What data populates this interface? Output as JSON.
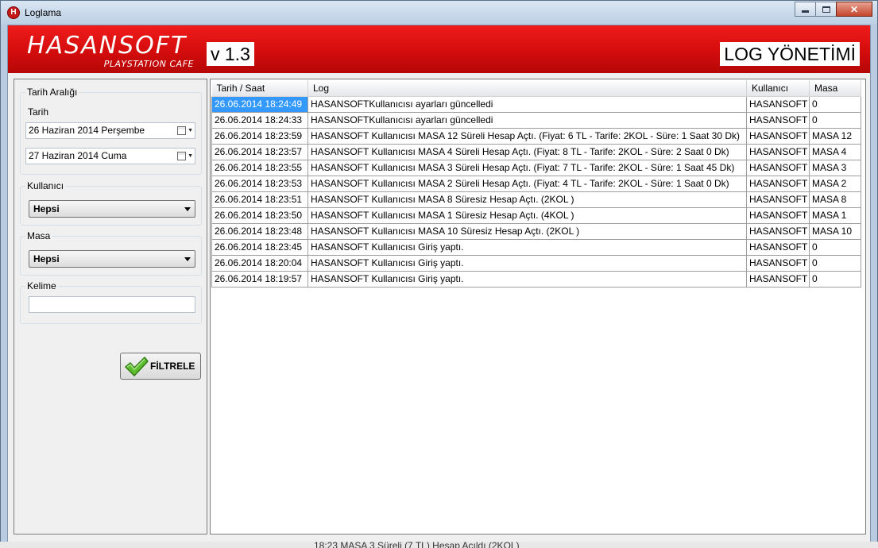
{
  "window": {
    "title": "Loglama",
    "app_icon_glyph": "H",
    "close_glyph": "✕"
  },
  "banner": {
    "logo_main": "HASANSOFT",
    "logo_sub": "PLAYSTATION CAFE",
    "version": "v 1.3",
    "page_title": "LOG YÖNETİMİ"
  },
  "filters": {
    "date_range_legend": "Tarih Aralığı",
    "date_label": "Tarih",
    "date_start": "26  Haziran  2014 Perşembe",
    "date_end": "27  Haziran  2014    Cuma",
    "user_legend": "Kullanıcı",
    "user_selected": "Hepsi",
    "table_legend": "Masa",
    "table_selected": "Hepsi",
    "keyword_legend": "Kelime",
    "keyword_value": "",
    "filter_button_label": "FİLTRELE"
  },
  "log_table": {
    "columns": [
      "Tarih / Saat",
      "Log",
      "Kullanıcı",
      "Masa"
    ],
    "rows": [
      [
        "26.06.2014 18:24:49",
        "HASANSOFTKullanıcısı ayarları güncelledi",
        "HASANSOFT",
        "0"
      ],
      [
        "26.06.2014 18:24:33",
        "HASANSOFTKullanıcısı ayarları güncelledi",
        "HASANSOFT",
        "0"
      ],
      [
        "26.06.2014 18:23:59",
        "HASANSOFT Kullanıcısı MASA 12 Süreli Hesap Açtı. (Fiyat: 6 TL - Tarife: 2KOL - Süre: 1 Saat 30 Dk)",
        "HASANSOFT",
        "MASA 12"
      ],
      [
        "26.06.2014 18:23:57",
        "HASANSOFT Kullanıcısı MASA 4 Süreli Hesap Açtı. (Fiyat: 8 TL - Tarife: 2KOL - Süre: 2 Saat 0 Dk)",
        "HASANSOFT",
        "MASA 4"
      ],
      [
        "26.06.2014 18:23:55",
        "HASANSOFT Kullanıcısı MASA 3 Süreli Hesap Açtı. (Fiyat: 7 TL - Tarife: 2KOL - Süre: 1 Saat 45 Dk)",
        "HASANSOFT",
        "MASA 3"
      ],
      [
        "26.06.2014 18:23:53",
        "HASANSOFT Kullanıcısı MASA 2 Süreli Hesap Açtı. (Fiyat: 4 TL - Tarife: 2KOL - Süre: 1 Saat 0 Dk)",
        "HASANSOFT",
        "MASA 2"
      ],
      [
        "26.06.2014 18:23:51",
        "HASANSOFT Kullanıcısı MASA 8 Süresiz Hesap Açtı. (2KOL )",
        "HASANSOFT",
        "MASA 8"
      ],
      [
        "26.06.2014 18:23:50",
        "HASANSOFT Kullanıcısı MASA 1 Süresiz Hesap Açtı. (4KOL )",
        "HASANSOFT",
        "MASA 1"
      ],
      [
        "26.06.2014 18:23:48",
        "HASANSOFT Kullanıcısı MASA 10 Süresiz Hesap Açtı. (2KOL )",
        "HASANSOFT",
        "MASA 10"
      ],
      [
        "26.06.2014 18:23:45",
        "HASANSOFT Kullanıcısı Giriş yaptı.",
        "HASANSOFT",
        "0"
      ],
      [
        "26.06.2014 18:20:04",
        "HASANSOFT Kullanıcısı Giriş yaptı.",
        "HASANSOFT",
        "0"
      ],
      [
        "26.06.2014 18:19:57",
        "HASANSOFT Kullanıcısı Giriş yaptı.",
        "HASANSOFT",
        "0"
      ]
    ],
    "selected_row": 0
  },
  "background_text": "18:23  MASA 3 Süreli (7 TL) Hesap Açıldı (2KOL)",
  "colors": {
    "banner_red": "#d40c0c",
    "selection_blue": "#3399ff"
  },
  "icons": {
    "app": "hasansoft-app-icon",
    "calendar": "calendar-icon",
    "dropdown": "chevron-down-icon",
    "filter_button": "checkmark-icon"
  }
}
